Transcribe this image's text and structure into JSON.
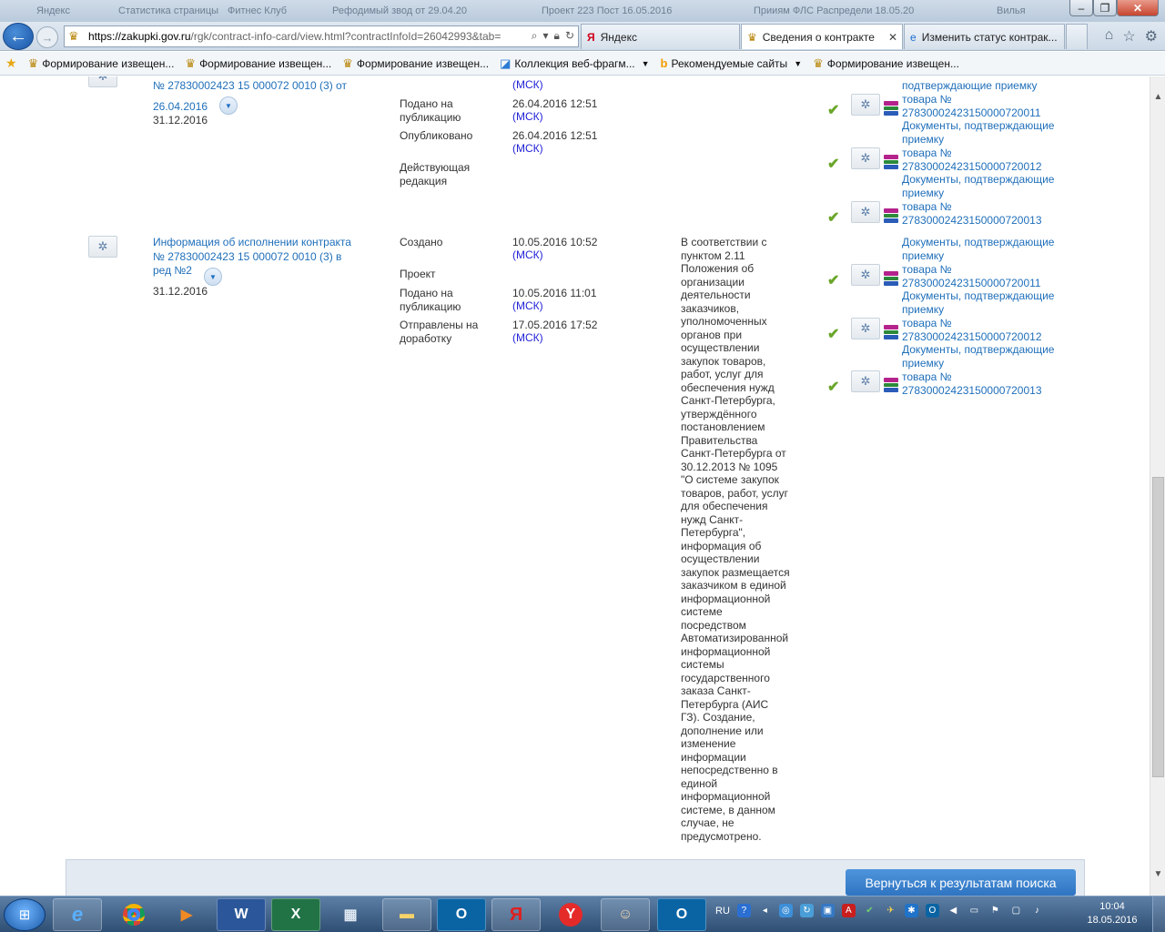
{
  "browser": {
    "ghost_tabs": [
      "Яндекс",
      "Статистика страницы",
      "Фитнес Клуб",
      "Рефодимый звод от 29.04.20",
      "Проект 223 Пост 16.05.2016",
      "Прииям ФЛС Распредели 18.05.20",
      "Вилья"
    ],
    "url_domain": "https://zakupki.gov.ru",
    "url_path": "/rgk/contract-info-card/view.html?contractInfoId=26042993&tab=",
    "tabs": [
      {
        "label": "Яндекс",
        "icon": "yandex-icon"
      },
      {
        "label": "Сведения о контракте",
        "icon": "gov-emblem-icon"
      },
      {
        "label": "Изменить статус контрак...",
        "icon": "ie-icon"
      }
    ],
    "favorites": [
      {
        "label": "Формирование извещен..."
      },
      {
        "label": "Формирование извещен..."
      },
      {
        "label": "Формирование извещен..."
      },
      {
        "label": "Коллекция веб-фрагм..."
      },
      {
        "label": "Рекомендуемые сайты"
      },
      {
        "label": "Формирование извещен..."
      }
    ]
  },
  "record1": {
    "title_partial": "№ 27830002423 15 000072 0010 (3) от",
    "date": "26.04.2016",
    "end_date": "31.12.2016",
    "msk_top": "(МСК)",
    "events": [
      {
        "label": "Подано на публикацию",
        "value": "26.04.2016 12:51",
        "tz": "(МСК)"
      },
      {
        "label": "Опубликовано",
        "value": "26.04.2016 12:51",
        "tz": "(МСК)"
      },
      {
        "label": "Действующая редакция",
        "value": "",
        "tz": ""
      }
    ],
    "docs": [
      {
        "prefix": "подтверждающие приемку",
        "line": "товара №",
        "number": "27830002423150000720011"
      },
      {
        "prefix": "Документы, подтверждающие приемку",
        "line": "товара №",
        "number": "27830002423150000720012"
      },
      {
        "prefix": "Документы, подтверждающие приемку",
        "line": "товара №",
        "number": "27830002423150000720013"
      }
    ]
  },
  "record2": {
    "title": "Информация об исполнении контракта № 27830002423 15 000072 0010 (3) в ред №2",
    "end_date": "31.12.2016",
    "events": [
      {
        "label": "Создано",
        "value": "10.05.2016 10:52",
        "tz": "(МСК)"
      },
      {
        "label": "Проект",
        "value": "",
        "tz": ""
      },
      {
        "label": "Подано на публикацию",
        "value": "10.05.2016 11:01",
        "tz": "(МСК)"
      },
      {
        "label": "Отправлены на доработку",
        "value": "17.05.2016 17:52",
        "tz": "(МСК)"
      }
    ],
    "comment": "В соответствии с пунктом 2.11 Положения об организации деятельности заказчиков, уполномоченных органов при осуществлении закупок товаров, работ, услуг для обеспечения нужд Санкт-Петербурга, утверждённого постановлением Правительства Санкт-Петербурга от 30.12.2013 № 1095 \"О системе закупок товаров, работ, услуг для обеспечения нужд Санкт-Петербурга\", информация об осуществлении закупок размещается заказчиком в единой информационной системе посредством Автоматизированной информационной системы государственного заказа Санкт-Петербурга (АИС ГЗ). Создание, дополнение или изменение информации непосредственно в единой информационной системе, в данном случае, не предусмотрено.",
    "docs": [
      {
        "prefix": "Документы, подтверждающие приемку",
        "line": "товара №",
        "number": "27830002423150000720011"
      },
      {
        "prefix": "Документы, подтверждающие приемку",
        "line": "товара №",
        "number": "27830002423150000720012"
      },
      {
        "prefix": "Документы, подтверждающие приемку",
        "line": "товара №",
        "number": "27830002423150000720013"
      }
    ]
  },
  "return_button": "Вернуться к результатам поиска",
  "taskbar": {
    "lang": "RU",
    "time": "10:04",
    "date": "18.05.2016"
  }
}
